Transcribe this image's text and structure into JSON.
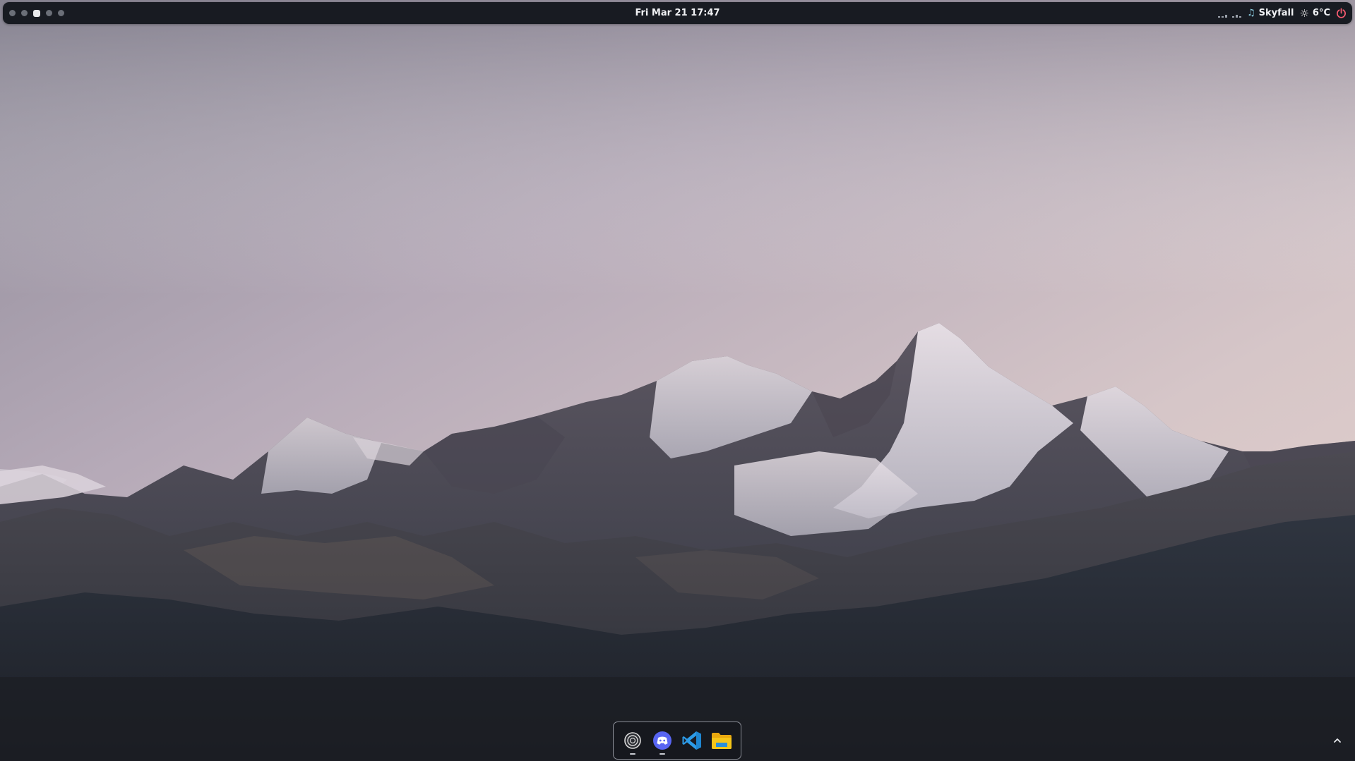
{
  "topbar": {
    "workspaces": [
      {
        "label": "workspace-1",
        "active": false
      },
      {
        "label": "workspace-2",
        "active": false
      },
      {
        "label": "workspace-3",
        "active": true
      },
      {
        "label": "workspace-4",
        "active": false
      },
      {
        "label": "workspace-5",
        "active": false
      }
    ],
    "clock": "Fri Mar 21 17:47",
    "tray": {
      "network_icon": "network-activity-icon",
      "music_icon": "music-note-icon",
      "music_title": "Skyfall",
      "weather_icon": "sun-icon",
      "temperature": "6°C",
      "power_icon": "power-icon"
    }
  },
  "dock": {
    "apps": [
      {
        "name": "obs-studio",
        "icon": "obs-icon",
        "running": true
      },
      {
        "name": "discord",
        "icon": "discord-icon",
        "running": true
      },
      {
        "name": "vscode",
        "icon": "vscode-icon",
        "running": false
      },
      {
        "name": "files",
        "icon": "folder-icon",
        "running": false
      }
    ]
  },
  "corner": {
    "icon": "chevron-up-icon"
  },
  "colors": {
    "bar_bg": "#181b22",
    "accent_music": "#8fd4e8",
    "power": "#ff5c72",
    "discord": "#5865f2",
    "vscode": "#2c9be8",
    "folder": "#f5c518"
  }
}
